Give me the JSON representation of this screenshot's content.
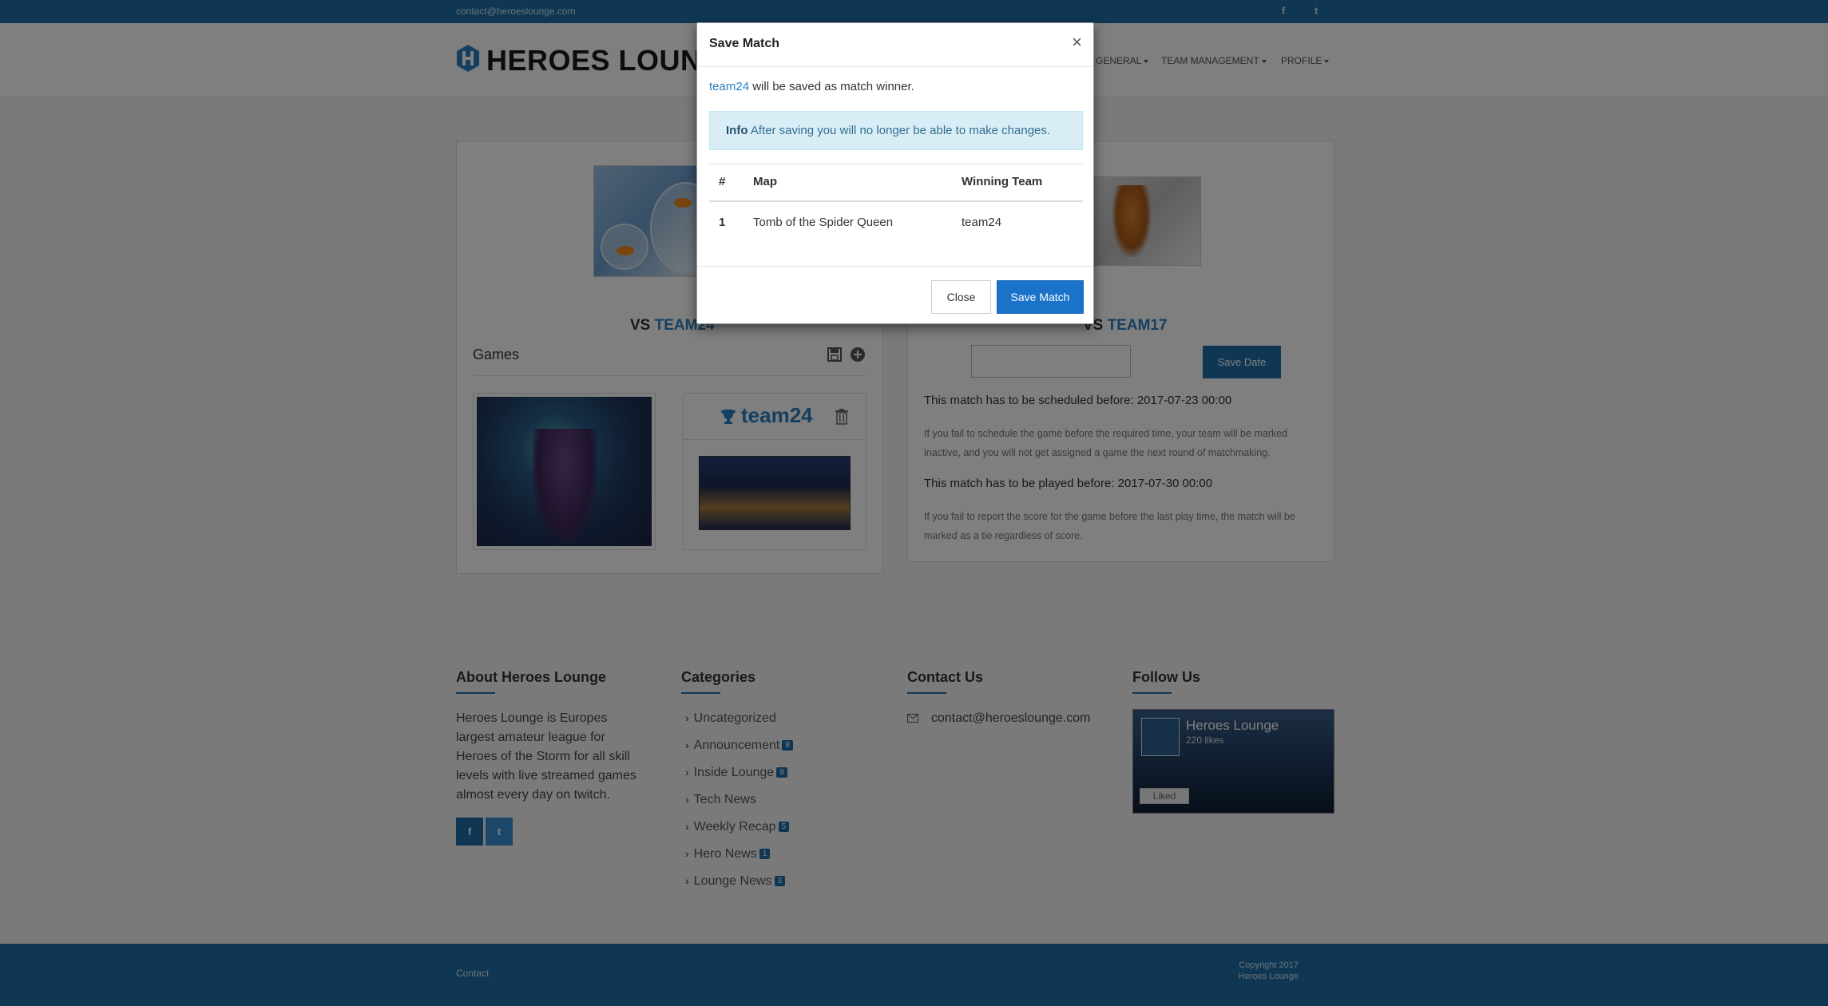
{
  "topbar": {
    "email": "contact@heroeslounge.com",
    "facebook_glyph": "f",
    "twitter_glyph": "t"
  },
  "header": {
    "logo_text": "HEROES LOUNGE",
    "nav": [
      {
        "label": "GENERAL"
      },
      {
        "label": "TEAM MANAGEMENT"
      },
      {
        "label": "PROFILE"
      }
    ]
  },
  "match": {
    "left_vs_prefix": "VS ",
    "left_team": "TEAM24",
    "right_vs_prefix": "VS ",
    "right_team": "TEAM17",
    "games_title": "Games",
    "winner_name": "team24",
    "save_date_label": "Save Date",
    "schedule_before": "This match has to be scheduled before: 2017-07-23 00:00",
    "schedule_note": "If you fail to schedule the game before the required time, your team will be marked inactive, and you will not get assigned a game the next round of matchmaking.",
    "play_before": "This match has to be played before: 2017-07-30 00:00",
    "play_note": "If you fail to report the score for the game before the last play time, the match will be marked as a tie regardless of score."
  },
  "footer": {
    "about_title": "About Heroes Lounge",
    "about_text": "Heroes Lounge is Europes largest amateur league for Heroes of the Storm for all skill levels with live streamed games almost every day on twitch.",
    "categories_title": "Categories",
    "categories": [
      {
        "label": "Uncategorized",
        "count": ""
      },
      {
        "label": "Announcement",
        "count": "8"
      },
      {
        "label": "Inside Lounge",
        "count": "9"
      },
      {
        "label": "Tech News",
        "count": ""
      },
      {
        "label": "Weekly Recap",
        "count": "5"
      },
      {
        "label": "Hero News",
        "count": "1"
      },
      {
        "label": "Lounge News",
        "count": "3"
      }
    ],
    "contact_title": "Contact Us",
    "contact_email": "contact@heroeslounge.com",
    "follow_title": "Follow Us",
    "fb_page_name": "Heroes Lounge",
    "fb_likes": "220 likes",
    "fb_liked": "Liked",
    "fb_social_f": "f",
    "fb_social_t": "t"
  },
  "bottombar": {
    "contact": "Contact",
    "copyright_line1": "Copyright 2017",
    "copyright_line2": "Heroes Lounge"
  },
  "modal": {
    "title": "Save Match",
    "close_x": "×",
    "winner_team": "team24",
    "winner_suffix": " will be saved as match winner.",
    "info_label": "Info",
    "info_text": " After saving you will no longer be able to make changes.",
    "table": {
      "headers": [
        "#",
        "Map",
        "Winning Team"
      ],
      "rows": [
        [
          "1",
          "Tomb of the Spider Queen",
          "team24"
        ]
      ]
    },
    "close_label": "Close",
    "save_label": "Save Match"
  },
  "colors": {
    "brand": "#1f6fa8",
    "link": "#2a7fc1",
    "primary_button": "#1a73c9",
    "info_bg": "#d9edf7"
  }
}
